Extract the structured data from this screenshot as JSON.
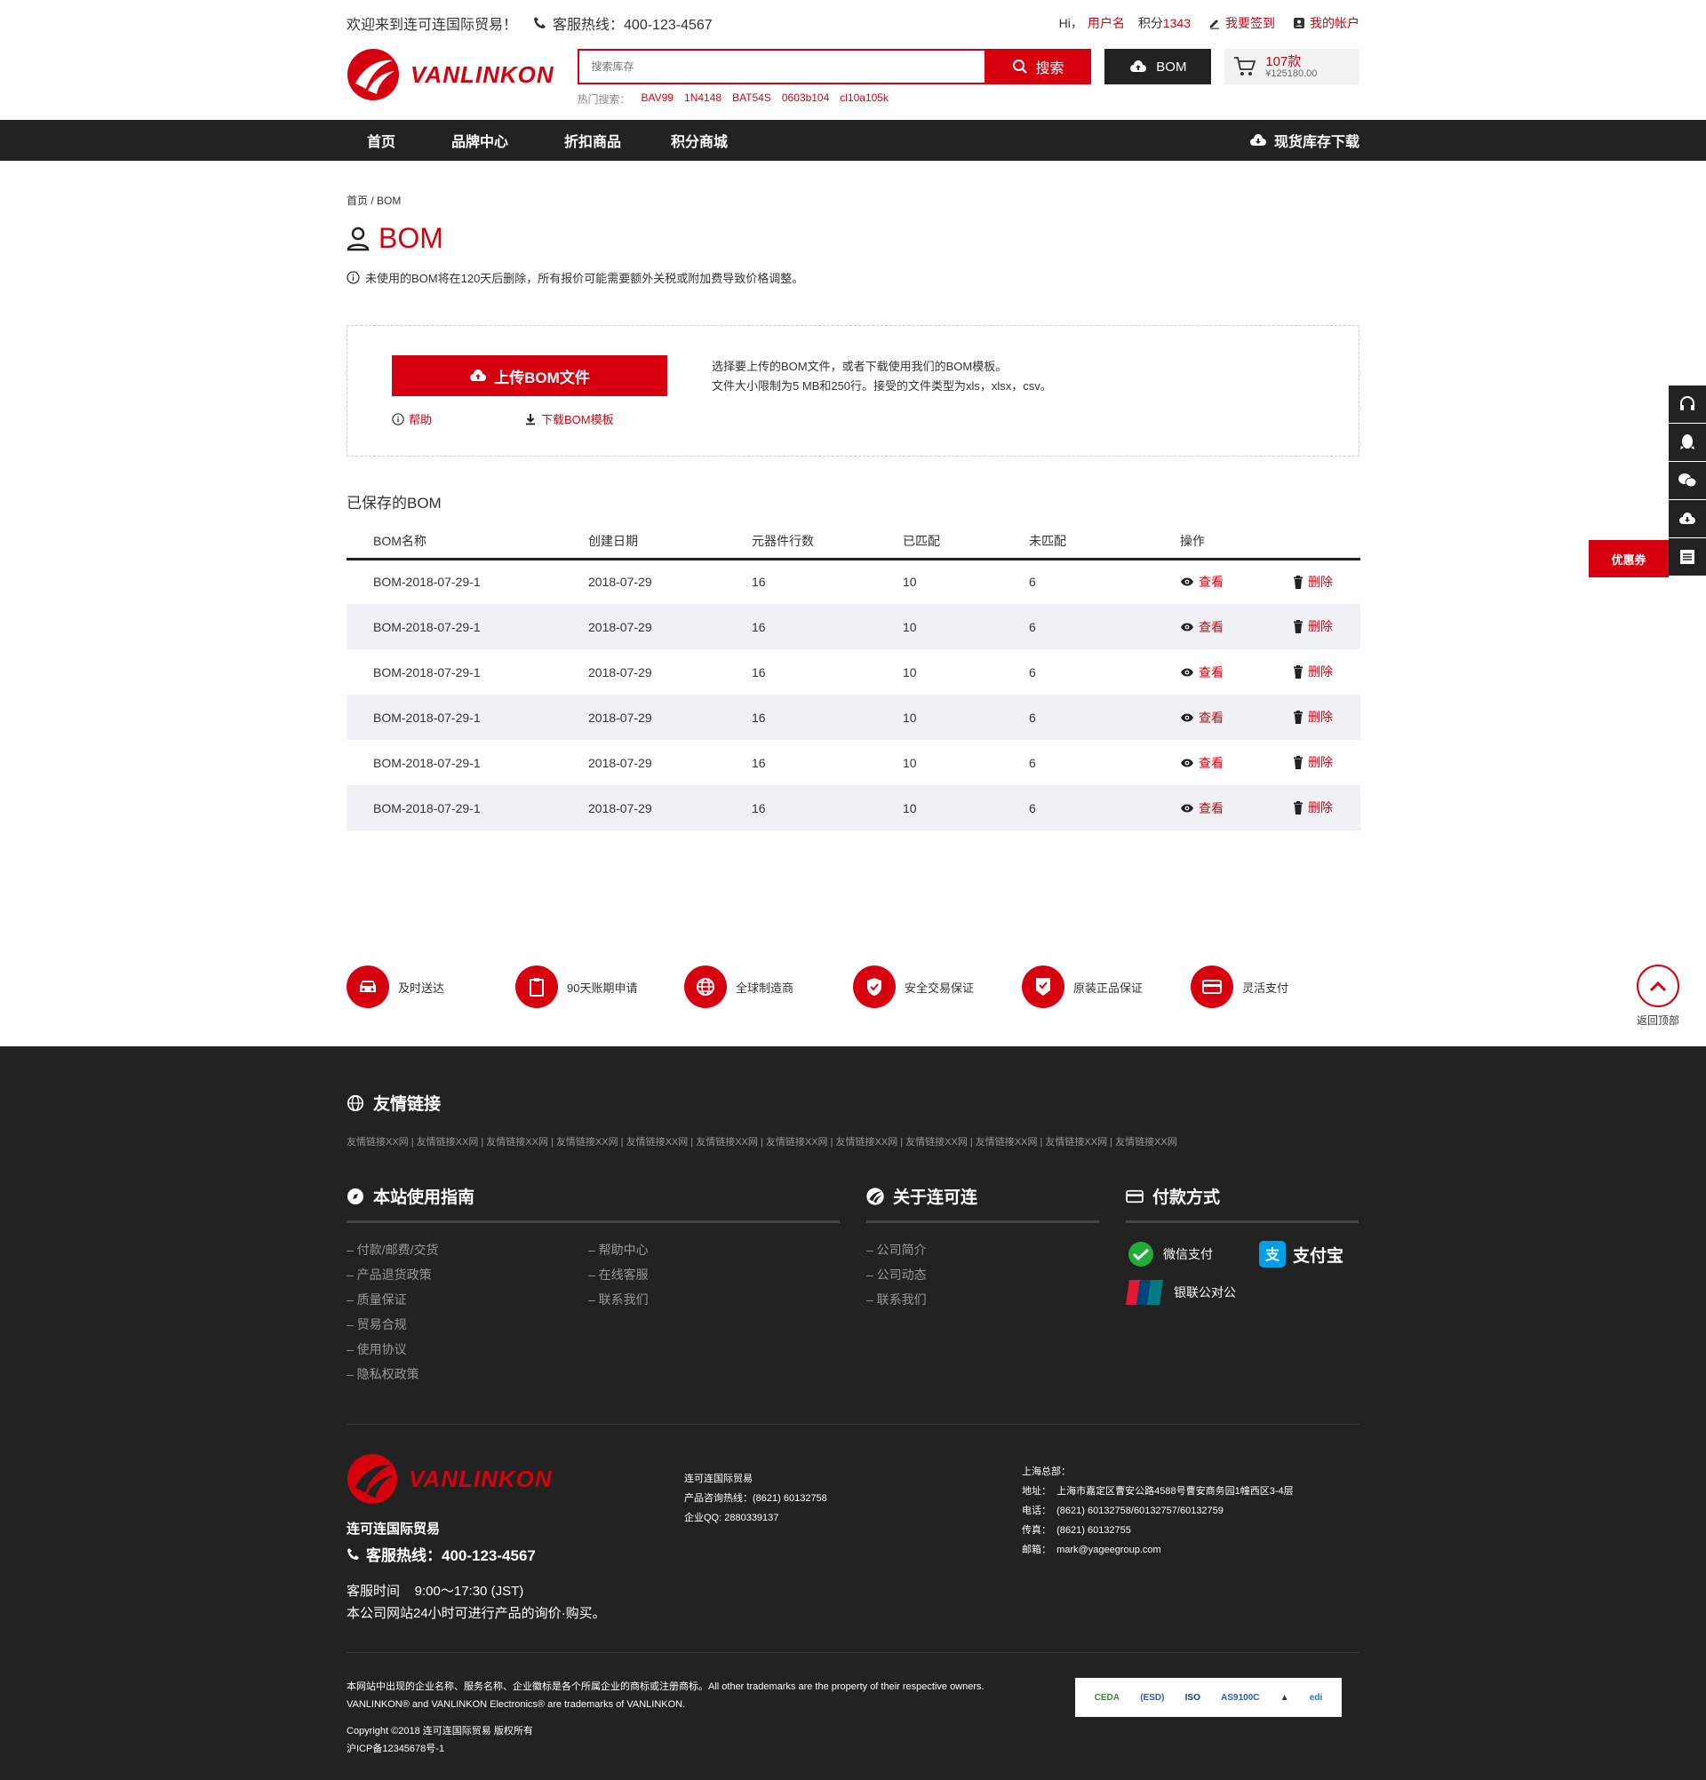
{
  "topbar": {
    "welcome": "欢迎来到连可连国际贸易！",
    "hotline": "客服热线：400-123-4567",
    "hi": "Hi，",
    "username": "用户名",
    "points_label": "积分",
    "points": "1343",
    "signin": "我要签到",
    "account": "我的帐户"
  },
  "logo": {
    "name": "VANLINKON"
  },
  "search": {
    "placeholder": "搜索库存",
    "button": "搜索",
    "hot_label": "热门搜索：",
    "hot": [
      "BAV99",
      "1N4148",
      "BAT54S",
      "0603b104",
      "cl10a105k"
    ]
  },
  "bom_button": "BOM",
  "cart": {
    "count": "107款",
    "total": "¥125180.00"
  },
  "nav": {
    "items": [
      "首页",
      "品牌中心",
      "折扣商品",
      "积分商城"
    ],
    "download": "现货库存下载"
  },
  "breadcrumb": "首页 / BOM",
  "page_title": "BOM",
  "notice": "未使用的BOM将在120天后删除，所有报价可能需要额外关税或附加费导致价格调整。",
  "upload": {
    "button": "上传BOM文件",
    "help": "帮助",
    "template": "下载BOM模板",
    "desc1": "选择要上传的BOM文件，或者下载使用我们的BOM模板。",
    "desc2": "文件大小限制为5 MB和250行。接受的文件类型为xls，xlsx，csv。"
  },
  "saved_title": "已保存的BOM",
  "table": {
    "headers": [
      "BOM名称",
      "创建日期",
      "元器件行数",
      "已匹配",
      "未匹配",
      "操作",
      ""
    ],
    "view": "查看",
    "delete": "删除",
    "rows": [
      [
        "BOM-2018-07-29-1",
        "2018-07-29",
        "16",
        "10",
        "6"
      ],
      [
        "BOM-2018-07-29-1",
        "2018-07-29",
        "16",
        "10",
        "6"
      ],
      [
        "BOM-2018-07-29-1",
        "2018-07-29",
        "16",
        "10",
        "6"
      ],
      [
        "BOM-2018-07-29-1",
        "2018-07-29",
        "16",
        "10",
        "6"
      ],
      [
        "BOM-2018-07-29-1",
        "2018-07-29",
        "16",
        "10",
        "6"
      ],
      [
        "BOM-2018-07-29-1",
        "2018-07-29",
        "16",
        "10",
        "6"
      ]
    ]
  },
  "features": [
    "及时送达",
    "90天账期申请",
    "全球制造商",
    "安全交易保证",
    "原装正品保证",
    "灵活支付"
  ],
  "side": {
    "coupon": "优惠券",
    "totop": "返回顶部"
  },
  "footer": {
    "friends_title": "友情链接",
    "friends": "友情链接XX网 | 友情链接XX网 | 友情链接XX网 | 友情链接XX网 | 友情链接XX网 | 友情链接XX网 | 友情链接XX网 | 友情链接XX网 | 友情链接XX网 | 友情链接XX网 | 友情链接XX网 | 友情链接XX网",
    "guide_title": "本站使用指南",
    "guide_col1": [
      "– 付款/邮费/交货",
      "– 产品退货政策",
      "– 质量保证",
      "– 贸易合规",
      "– 使用协议",
      "– 隐私权政策"
    ],
    "guide_col2": [
      "– 帮助中心",
      "– 在线客服",
      "– 联系我们"
    ],
    "about_title": "关于连可连",
    "about": [
      "– 公司简介",
      "– 公司动态",
      "– 联系我们"
    ],
    "pay_title": "付款方式",
    "pay": [
      "微信支付",
      "支付宝",
      "银联公对公"
    ],
    "company": "连可连国际贸易",
    "hotline": "客服热线：400-123-4567",
    "hours": "客服时间    9:00～17:30 (JST)",
    "online": "本公司网站24小时可进行产品的询价·购买。",
    "contact1": [
      "连可连国际贸易",
      "产品咨询热线：(8621) 60132758",
      "企业QQ: 2880339137"
    ],
    "contact2": [
      "上海总部：",
      "地址：  上海市嘉定区曹安公路4588号曹安商务园1幢西区3-4层",
      "电话：  (8621) 60132758/60132757/60132759",
      "传真：  (8621) 60132755",
      "邮箱：  mark@yageegroup.com"
    ],
    "legal1": "本网站中出现的企业名称、服务名称、企业徽标是各个所属企业的商标或注册商标。All other trademarks are the property of their respective owners. VANLINKON® and VANLINKON Electronics® are trademarks of VANLINKON.",
    "copyright": "Copyright ©2018 连可连国际贸易 版权所有",
    "icp": "沪ICP备12345678号-1",
    "certs": [
      "CEDA",
      "(ESD)",
      "ISO",
      "AS9100C",
      "▲",
      "edi"
    ]
  }
}
